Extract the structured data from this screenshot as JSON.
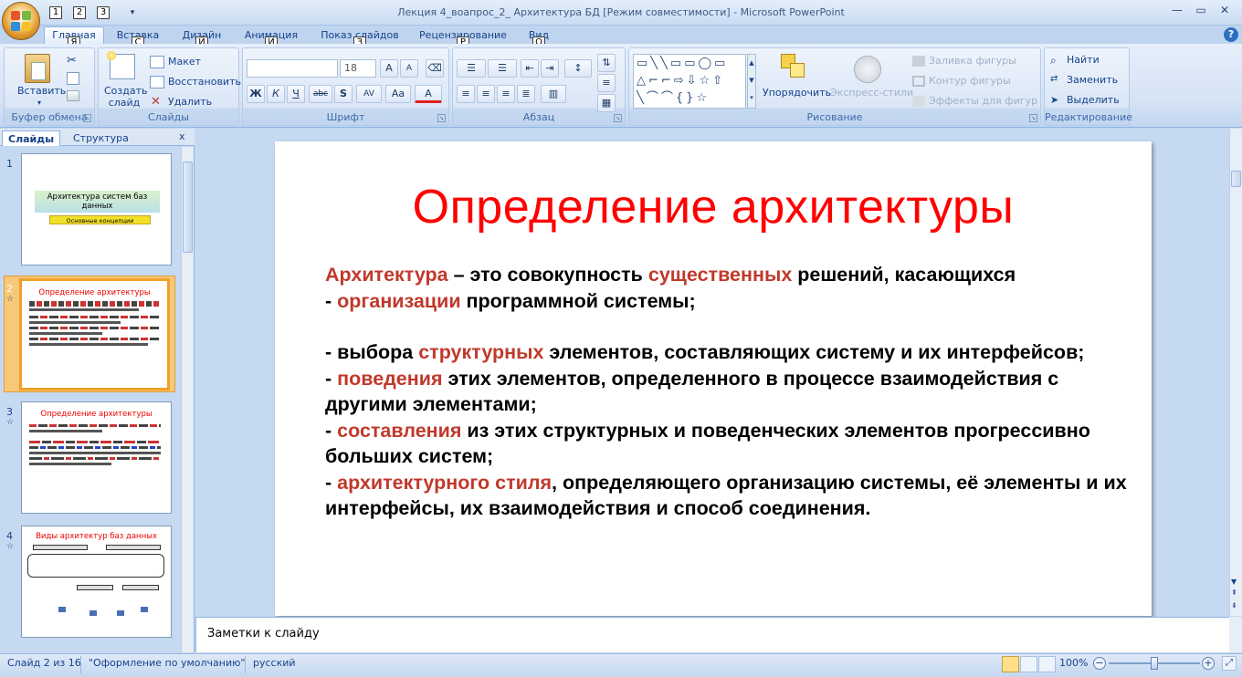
{
  "window": {
    "title": "Лекция 4_воапрос_2_ Архитектура БД  [Режим совместимости] - Microsoft PowerPoint",
    "qat_keytips": [
      "1",
      "2",
      "3"
    ]
  },
  "tabs": [
    {
      "label": "Главная",
      "keytip": "Я",
      "active": true
    },
    {
      "label": "Вставка",
      "keytip": "С"
    },
    {
      "label": "Дизайн",
      "keytip": "Й"
    },
    {
      "label": "Анимация",
      "keytip": "И"
    },
    {
      "label": "Показ слайдов",
      "keytip": "З"
    },
    {
      "label": "Рецензирование",
      "keytip": "Р"
    },
    {
      "label": "Вид",
      "keytip": "О"
    }
  ],
  "ribbon": {
    "clipboard": {
      "label": "Буфер обмена",
      "paste": "Вставить"
    },
    "slides": {
      "label": "Слайды",
      "new_slide": "Создать слайд",
      "layout": "Макет",
      "reset": "Восстановить",
      "delete": "Удалить"
    },
    "font": {
      "label": "Шрифт",
      "font_name": "",
      "font_size": "18",
      "bold": "Ж",
      "italic": "К",
      "underline": "Ч",
      "strike": "abc",
      "shadow": "S",
      "spacing": "AV",
      "case": "Aa",
      "color": "A"
    },
    "paragraph": {
      "label": "Абзац"
    },
    "drawing": {
      "label": "Рисование",
      "arrange": "Упорядочить",
      "quick_styles": "Экспресс-стили",
      "fill": "Заливка фигуры",
      "outline": "Контур фигуры",
      "effects": "Эффекты для фигур"
    },
    "editing": {
      "label": "Редактирование",
      "find": "Найти",
      "replace": "Заменить",
      "select": "Выделить"
    }
  },
  "slides_pane": {
    "tab_slides": "Слайды",
    "tab_outline": "Структура",
    "close": "x",
    "thumbs": [
      {
        "num": "1",
        "title": "Архитектура систем баз данных",
        "subtitle": "Основные концепции"
      },
      {
        "num": "2",
        "title": "Определение архитектуры",
        "selected": true
      },
      {
        "num": "3",
        "title": "Определение архитектуры"
      },
      {
        "num": "4",
        "title": "Виды архитектур баз данных"
      }
    ]
  },
  "slide": {
    "title": "Определение  архитектуры",
    "para1": [
      {
        "t": "Архитектура",
        "hl": true
      },
      {
        "t": " – это совокупность "
      },
      {
        "t": "существенных",
        "hl": true
      },
      {
        "t": " решений, касающихся"
      }
    ],
    "para2": [
      {
        "t": "- "
      },
      {
        "t": "организации",
        "hl": true
      },
      {
        "t": " программной системы;"
      }
    ],
    "para3": [
      {
        "t": "- выбора "
      },
      {
        "t": "структурных",
        "hl": true
      },
      {
        "t": " элементов, составляющих систему и их интерфейсов;"
      }
    ],
    "para4": [
      {
        "t": "- "
      },
      {
        "t": "поведения",
        "hl": true
      },
      {
        "t": " этих элементов, определенного в процессе взаимодействия с другими элементами;"
      }
    ],
    "para5": [
      {
        "t": "- "
      },
      {
        "t": "составления",
        "hl": true
      },
      {
        "t": " из этих структурных и поведенческих элементов прогрессивно больших систем;"
      }
    ],
    "para6": [
      {
        "t": "- "
      },
      {
        "t": "архитектурного стиля",
        "hl": true
      },
      {
        "t": ", определяющего организацию системы, её элементы и их интерфейсы, их взаимодействия и способ соединения."
      }
    ]
  },
  "notes": {
    "placeholder": "Заметки к слайду"
  },
  "status": {
    "slide_info": "Слайд 2 из 16",
    "theme": "\"Оформление по умолчанию\"",
    "language": "русский",
    "zoom": "100%",
    "zoom_fraction": 0.5
  },
  "colors": {
    "accent_text": "#c0392b",
    "title_red": "#ff0000",
    "selection": "#f0a02a"
  }
}
